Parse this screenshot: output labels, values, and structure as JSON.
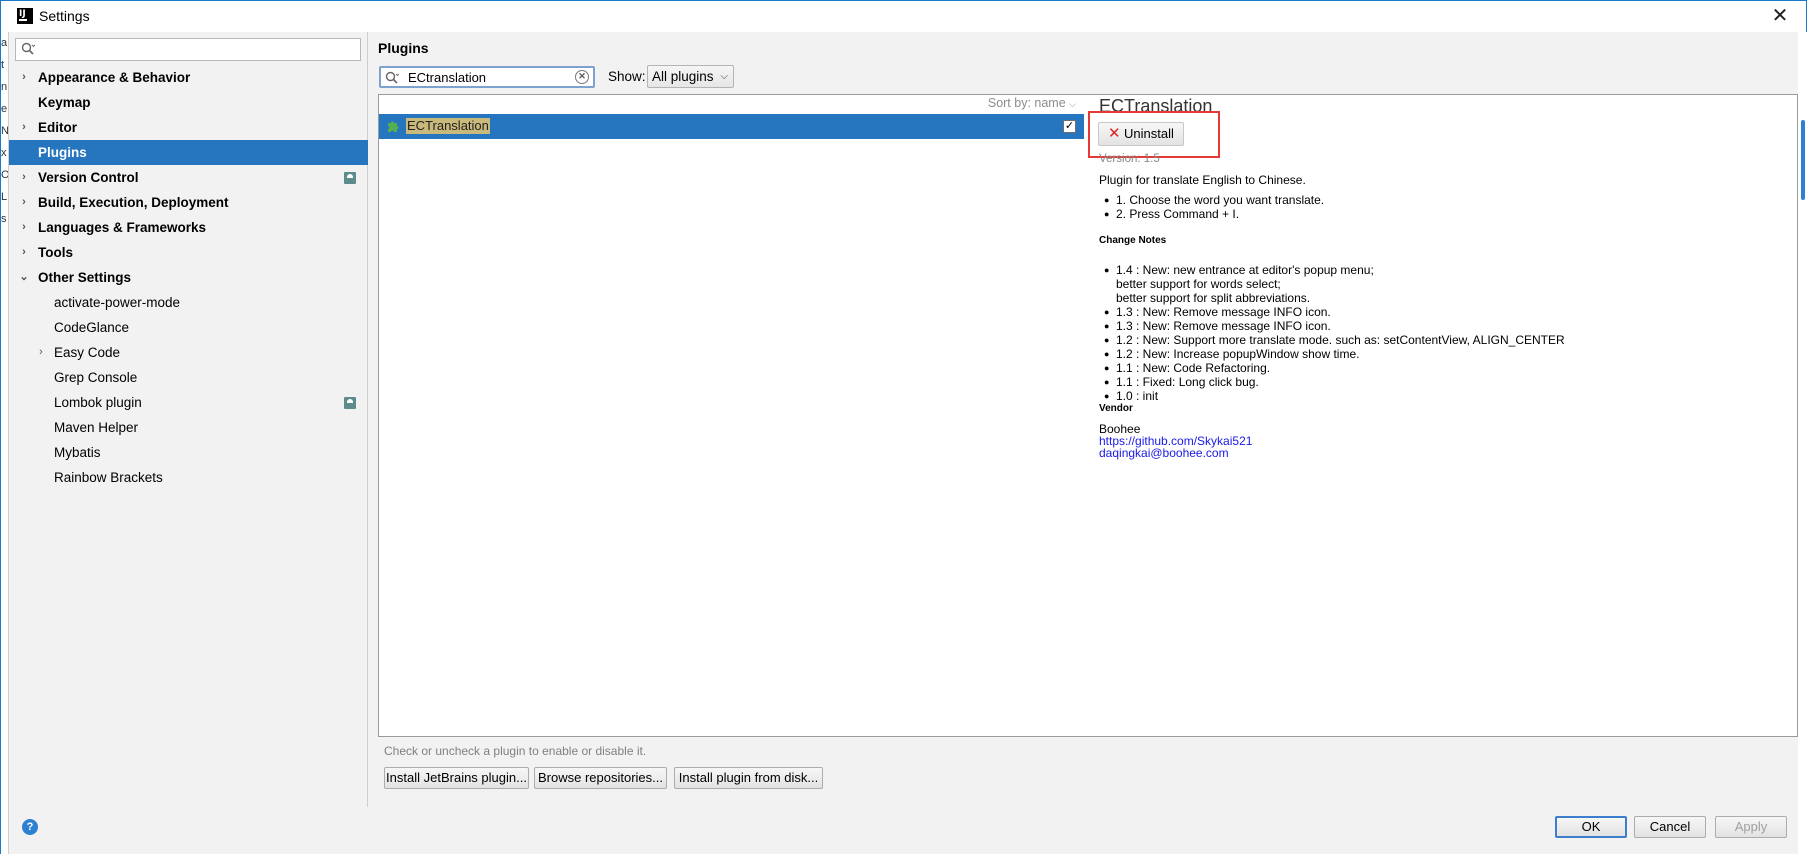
{
  "window": {
    "title": "Settings",
    "app_icon": "IJ"
  },
  "edge_strip": [
    "a",
    "t",
    "n",
    "e",
    "N",
    "x",
    "O",
    "L",
    "s"
  ],
  "sidebar": {
    "search_placeholder": "",
    "items": [
      {
        "label": "Appearance & Behavior",
        "bold": true,
        "arrow": "›",
        "level": 0
      },
      {
        "label": "Keymap",
        "bold": true,
        "arrow": "",
        "level": 0
      },
      {
        "label": "Editor",
        "bold": true,
        "arrow": "›",
        "level": 0
      },
      {
        "label": "Plugins",
        "bold": true,
        "arrow": "",
        "level": 0,
        "selected": true
      },
      {
        "label": "Version Control",
        "bold": true,
        "arrow": "›",
        "level": 0,
        "badge": true
      },
      {
        "label": "Build, Execution, Deployment",
        "bold": true,
        "arrow": "›",
        "level": 0
      },
      {
        "label": "Languages & Frameworks",
        "bold": true,
        "arrow": "›",
        "level": 0
      },
      {
        "label": "Tools",
        "bold": true,
        "arrow": "›",
        "level": 0
      },
      {
        "label": "Other Settings",
        "bold": true,
        "arrow": "⌄",
        "level": 0
      },
      {
        "label": "activate-power-mode",
        "level": 1
      },
      {
        "label": "CodeGlance",
        "level": 1
      },
      {
        "label": "Easy Code",
        "level": 1,
        "arrow": "›"
      },
      {
        "label": "Grep Console",
        "level": 1
      },
      {
        "label": "Lombok plugin",
        "level": 1,
        "badge": true
      },
      {
        "label": "Maven Helper",
        "level": 1
      },
      {
        "label": "Mybatis",
        "level": 1
      },
      {
        "label": "Rainbow Brackets",
        "level": 1
      }
    ]
  },
  "main": {
    "title": "Plugins",
    "search_value": "ECtranslation",
    "show_label": "Show:",
    "show_value": "All plugins",
    "sort_label": "Sort by: name",
    "plugin_row": {
      "name": "ECTranslation",
      "checked": true
    },
    "hint": "Check or uncheck a plugin to enable or disable it.",
    "buttons": {
      "install_jetbrains": "Install JetBrains plugin...",
      "browse": "Browse repositories...",
      "install_disk": "Install plugin from disk..."
    }
  },
  "detail": {
    "name": "ECTranslation",
    "uninstall_label": "Uninstall",
    "version": "Version: 1.5",
    "description": "Plugin for translate English to Chinese.",
    "usage": [
      "1. Choose the word you want translate.",
      "2. Press Command + I."
    ],
    "change_notes_heading": "Change Notes",
    "change_notes": [
      [
        "1.4 : New: new entrance at editor's popup menu;",
        "better support for words select;",
        "better support for split abbreviations."
      ],
      [
        "1.3 : New: Remove message INFO icon."
      ],
      [
        "1.3 : New: Remove message INFO icon."
      ],
      [
        "1.2 : New: Support more translate mode. such as: setContentView, ALIGN_CENTER"
      ],
      [
        "1.2 : New: Increase popupWindow show time."
      ],
      [
        "1.1 : New: Code Refactoring."
      ],
      [
        "1.1 : Fixed: Long click bug."
      ],
      [
        "1.0 : init"
      ]
    ],
    "vendor_heading": "Vendor",
    "vendor_name": "Boohee",
    "vendor_url": "https://github.com/Skykai521",
    "vendor_email": "daqingkai@boohee.com"
  },
  "footer": {
    "ok": "OK",
    "cancel": "Cancel",
    "apply": "Apply",
    "help": "?"
  },
  "colors": {
    "selection": "#2675bf",
    "highlight_box": "#e53935",
    "link": "#1a1ae6"
  }
}
